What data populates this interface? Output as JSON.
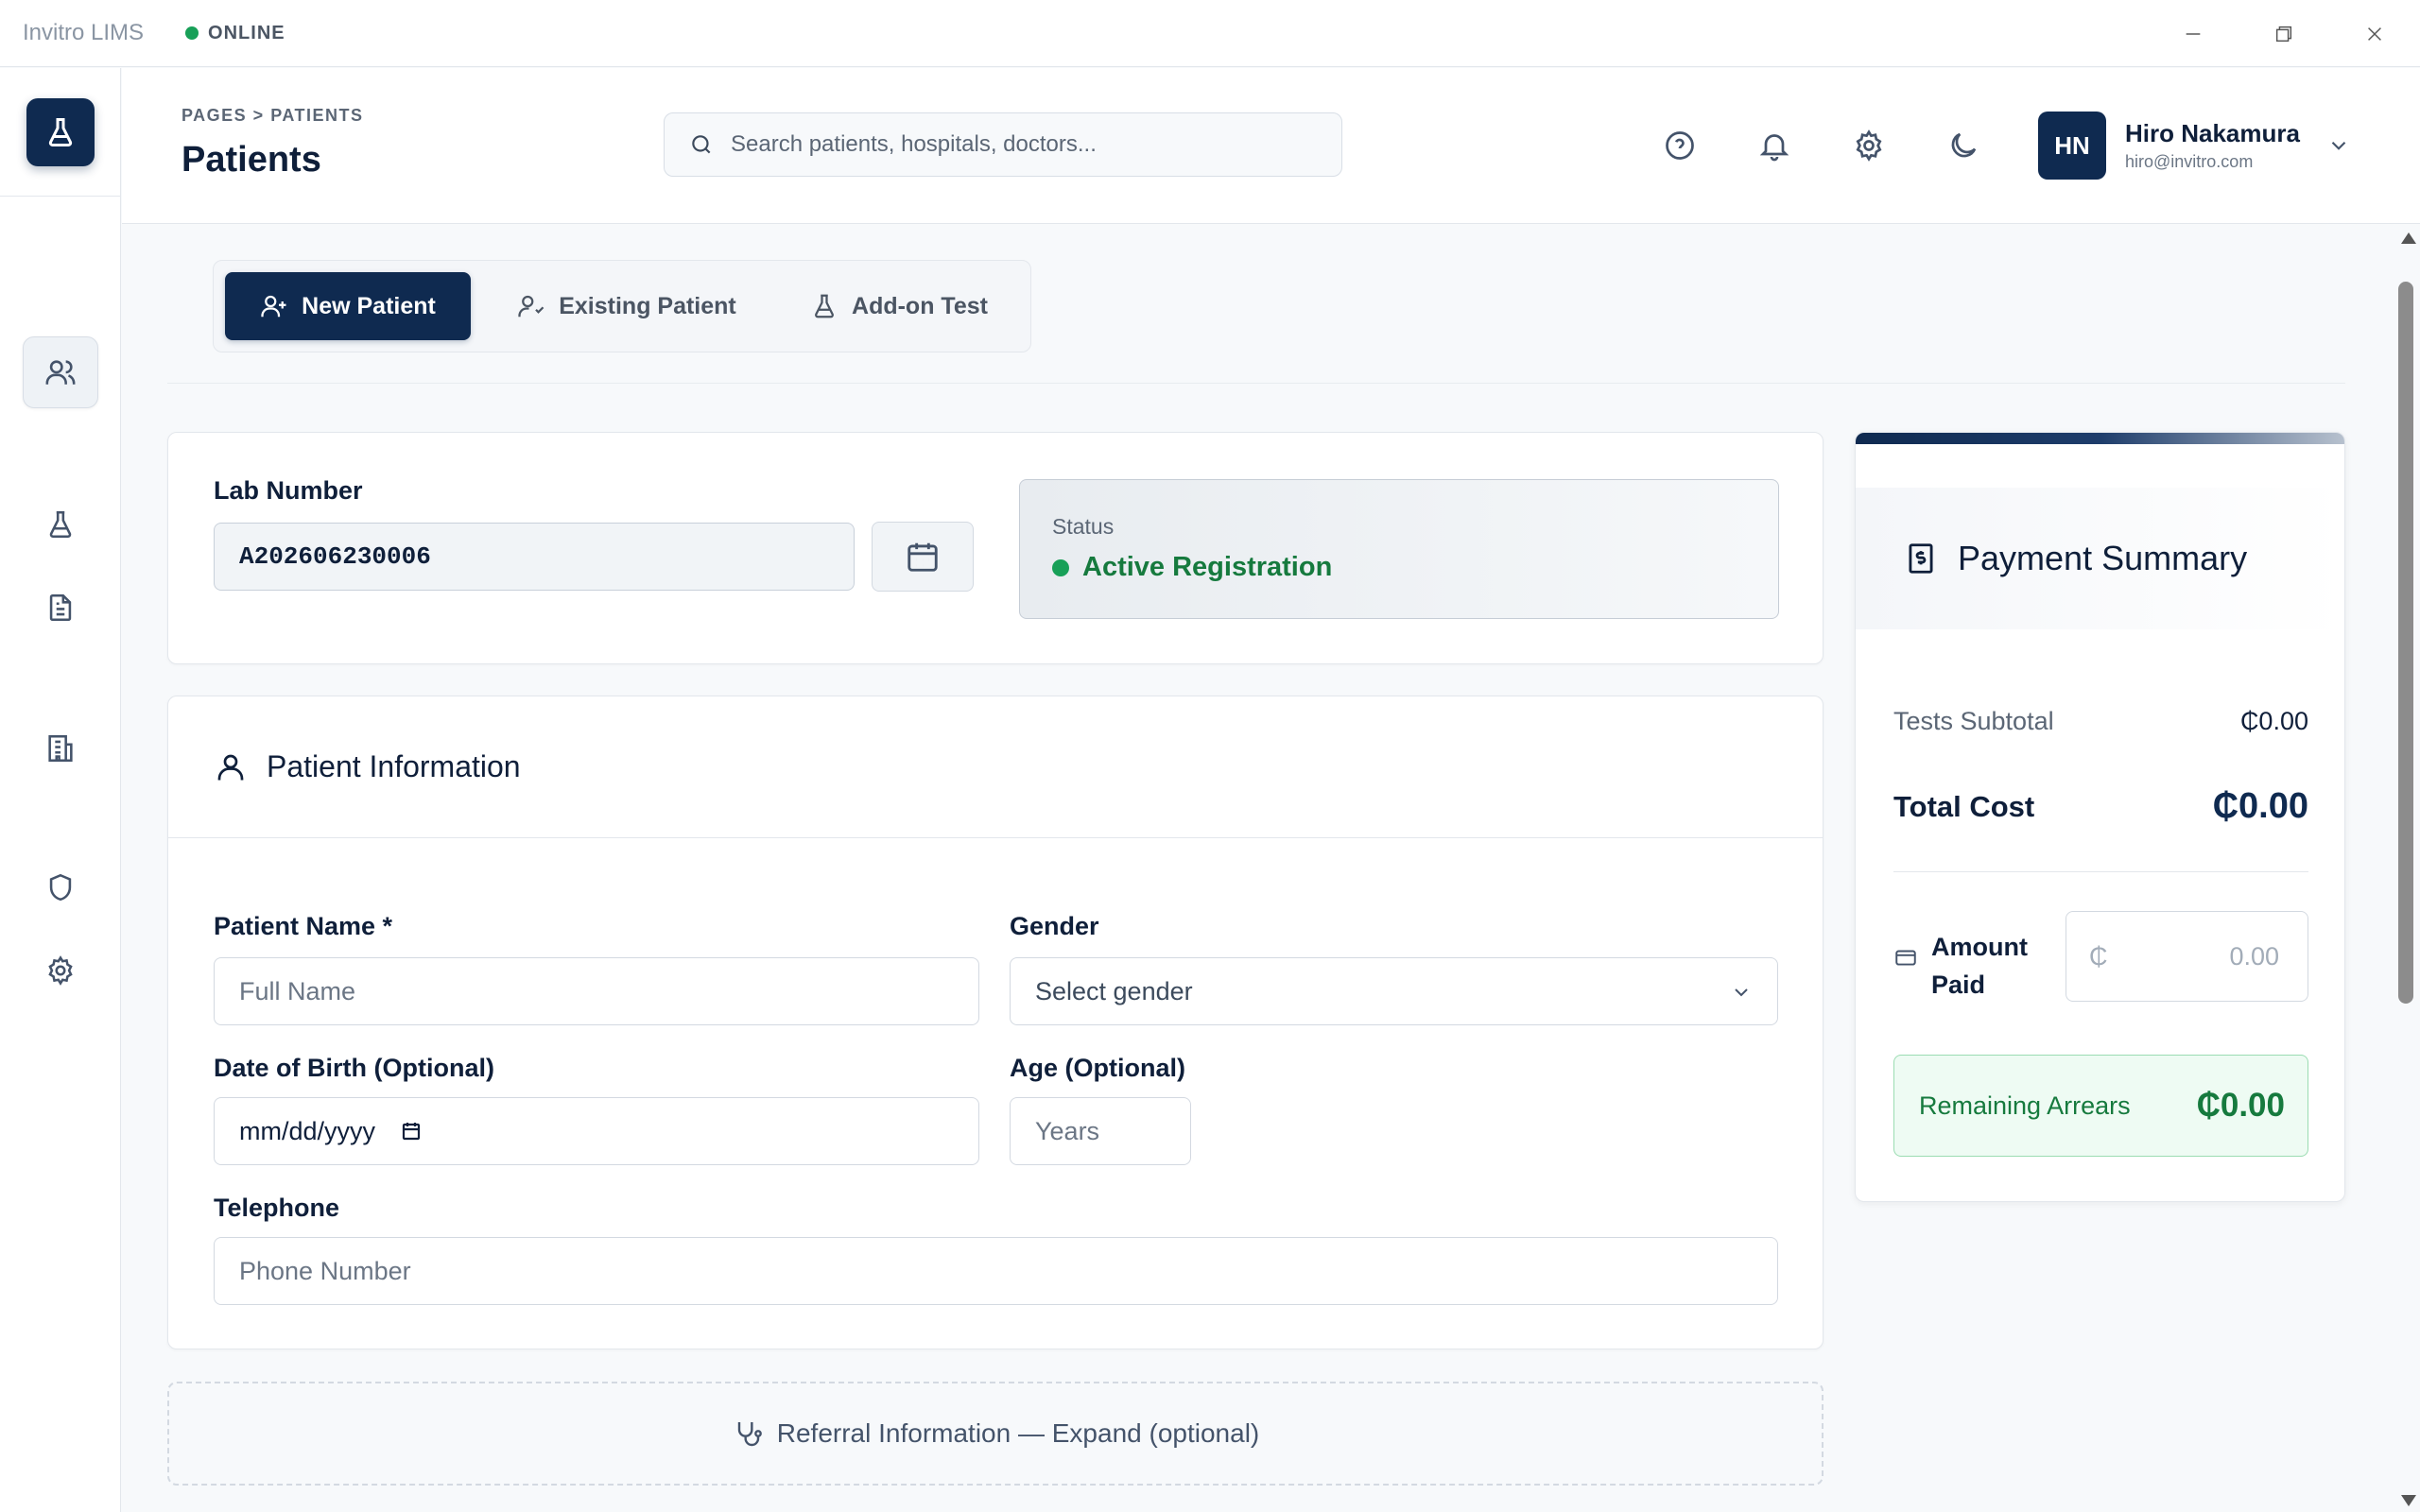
{
  "titlebar": {
    "app_name": "Invitro LIMS",
    "connection_status": "ONLINE"
  },
  "colors": {
    "brand": "#0f2a50",
    "success": "#18a058",
    "success_text": "#167a3e"
  },
  "sidebar": {
    "logo_icon": "flask-icon",
    "items": [
      {
        "name": "dashboard",
        "icon": "grid-icon",
        "active": false
      },
      {
        "name": "patients",
        "icon": "users-icon",
        "active": true
      },
      {
        "name": "tests",
        "icon": "flask-icon",
        "active": false
      },
      {
        "name": "reports",
        "icon": "document-icon",
        "active": false
      },
      {
        "name": "hospitals",
        "icon": "building-icon",
        "active": false
      },
      {
        "name": "security",
        "icon": "shield-icon",
        "active": false
      },
      {
        "name": "settings",
        "icon": "gear-icon",
        "active": false
      }
    ]
  },
  "header": {
    "breadcrumb": "PAGES > PATIENTS",
    "title": "Patients",
    "search_placeholder": "Search patients, hospitals, doctors...",
    "icons": [
      "help-icon",
      "bell-icon",
      "gear-icon",
      "moon-icon"
    ],
    "user": {
      "initials": "HN",
      "name": "Hiro Nakamura",
      "email": "hiro@invitro.com"
    }
  },
  "tabs": [
    {
      "label": "New Patient",
      "icon": "user-plus-icon",
      "active": true
    },
    {
      "label": "Existing Patient",
      "icon": "user-check-icon",
      "active": false
    },
    {
      "label": "Add-on Test",
      "icon": "flask-icon",
      "active": false
    }
  ],
  "lab": {
    "label": "Lab Number",
    "value": "A202606230006",
    "status_label": "Status",
    "status_value": "Active Registration"
  },
  "patient_info": {
    "title": "Patient Information",
    "name_label": "Patient Name *",
    "name_placeholder": "Full Name",
    "gender_label": "Gender",
    "gender_value": "Select gender",
    "dob_label": "Date of Birth (Optional)",
    "dob_placeholder": "mm/dd/yyyy",
    "age_label": "Age (Optional)",
    "age_placeholder": "Years",
    "phone_label": "Telephone",
    "phone_placeholder": "Phone Number"
  },
  "referral": {
    "label": "Referral Information — Expand (optional)"
  },
  "payment": {
    "title": "Payment Summary",
    "subtotal_label": "Tests Subtotal",
    "subtotal_value": "₵0.00",
    "total_label": "Total Cost",
    "total_value": "₵0.00",
    "amount_label_line1": "Amount",
    "amount_label_line2": "Paid",
    "currency_symbol": "₵",
    "amount_placeholder": "0.00",
    "arrears_label": "Remaining Arrears",
    "arrears_value": "₵0.00"
  }
}
